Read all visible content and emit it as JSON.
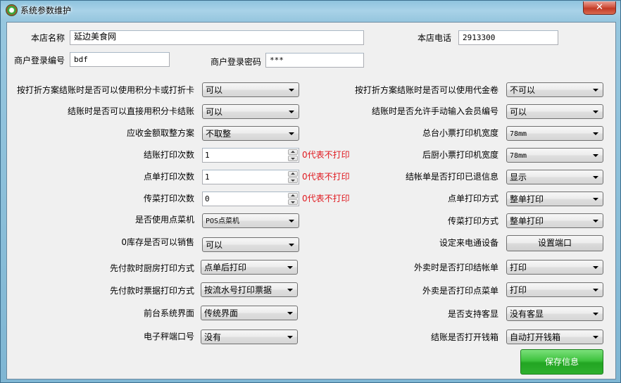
{
  "window": {
    "title": "系统参数维护",
    "close_glyph": "✕"
  },
  "colors": {
    "note_red": "#e0191f",
    "save_green": "#2fb02f"
  },
  "store": {
    "name_label": "本店名称",
    "name_value": "延边美食网",
    "phone_label": "本店电话",
    "phone_value": "2913300",
    "merchant_id_label": "商户登录编号",
    "merchant_id_value": "bdf",
    "merchant_pwd_label": "商户登录密码",
    "merchant_pwd_value": "***"
  },
  "left": [
    {
      "label": "按打折方案结账时是否可以使用积分卡或打折卡",
      "value": "可以"
    },
    {
      "label": "结账时是否可以直接用积分卡结账",
      "value": "可以"
    },
    {
      "label": "应收金额取整方案",
      "value": "不取整"
    },
    {
      "label": "结账打印次数",
      "value": "1",
      "note": "0代表不打印"
    },
    {
      "label": "点单打印次数",
      "value": "1",
      "note": "0代表不打印"
    },
    {
      "label": "传菜打印次数",
      "value": "0",
      "note": "0代表不打印"
    },
    {
      "label": "是否使用点菜机",
      "value": "POS点菜机"
    },
    {
      "label": "0库存是否可以销售",
      "value": "可以"
    },
    {
      "label": "先付款时厨房打印方式",
      "value": "点单后打印"
    },
    {
      "label": "先付款时票据打印方式",
      "value": "按流水号打印票据"
    },
    {
      "label": "前台系统界面",
      "value": "传统界面"
    },
    {
      "label": "电子秤端口号",
      "value": "没有"
    }
  ],
  "right": [
    {
      "label": "按打折方案结账时是否可以使用代金卷",
      "value": "不可以"
    },
    {
      "label": "结账时是否允许手动输入会员编号",
      "value": "可以"
    },
    {
      "label": "总台小票打印机宽度",
      "value": "78mm"
    },
    {
      "label": "后厨小票打印机宽度",
      "value": "78mm"
    },
    {
      "label": "结帐单是否打印已退信息",
      "value": "显示"
    },
    {
      "label": "点单打印方式",
      "value": "整单打印"
    },
    {
      "label": "传菜打印方式",
      "value": "整单打印"
    },
    {
      "label": "设定来电通设备",
      "button": "设置端口"
    },
    {
      "label": "外卖时是否打印结帐单",
      "value": "打印"
    },
    {
      "label": "外卖是否打印点菜单",
      "value": "打印"
    },
    {
      "label": "是否支持客显",
      "value": "没有客显"
    },
    {
      "label": "结账是否打开钱箱",
      "value": "自动打开钱箱"
    }
  ],
  "save_label": "保存信息"
}
